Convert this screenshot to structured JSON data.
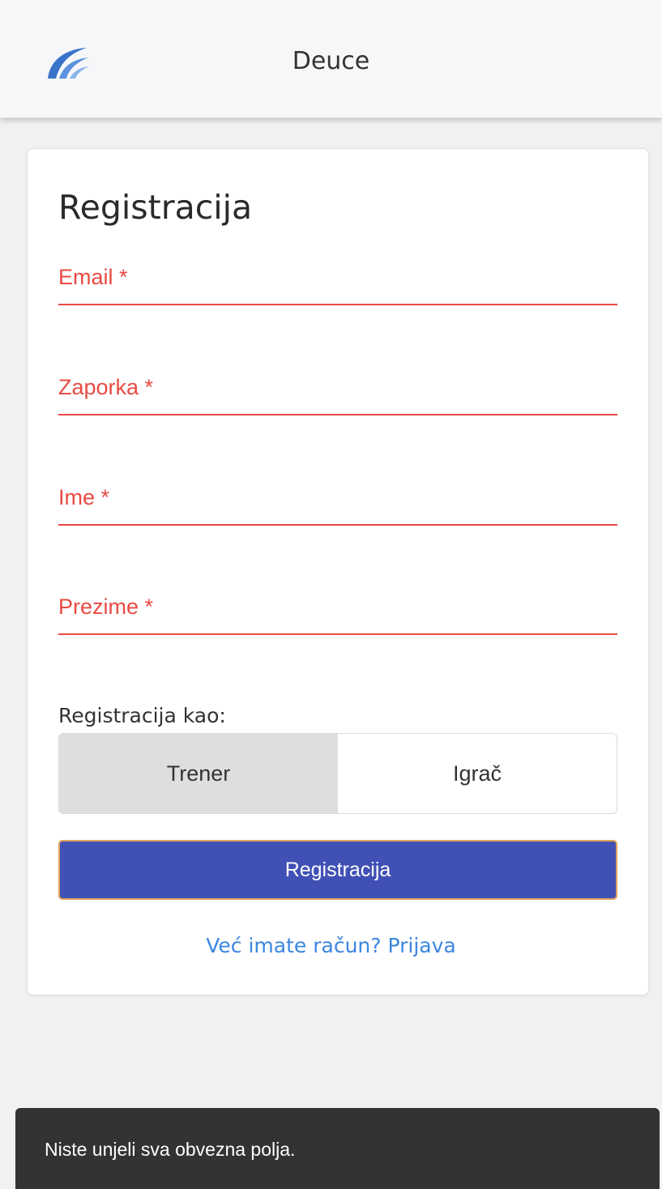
{
  "header": {
    "title": "Deuce",
    "logo_icon": "wave-logo-icon",
    "logo_color": "#3a73c9"
  },
  "form": {
    "title": "Registracija",
    "fields": [
      {
        "label": "Email *",
        "value": "",
        "type": "email"
      },
      {
        "label": "Zaporka *",
        "value": "",
        "type": "password"
      },
      {
        "label": "Ime *",
        "value": "",
        "type": "text"
      },
      {
        "label": "Prezime *",
        "value": "",
        "type": "text"
      }
    ],
    "error_color": "#e94a43",
    "role_label": "Registracija kao:",
    "roles": [
      {
        "label": "Trener",
        "selected": true
      },
      {
        "label": "Igrač",
        "selected": false
      }
    ],
    "submit_label": "Registracija",
    "submit_color": "#4150b5",
    "login_link": "Već imate račun? Prijava",
    "link_color": "#3b86e0"
  },
  "snackbar": {
    "message": "Niste unjeli sva obvezna polja."
  }
}
